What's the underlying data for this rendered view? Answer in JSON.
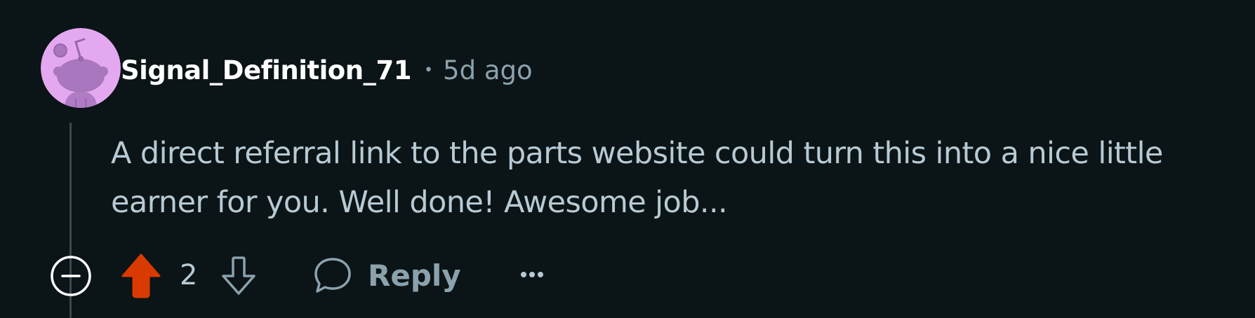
{
  "comment": {
    "username": "Signal_Definition_71",
    "separator": "•",
    "timestamp": "5d ago",
    "body": "A direct referral link to the parts website could turn this into a nice little earner for you. Well done! Awesome job...",
    "avatar_icon": "snoo-avatar",
    "avatar_color": "#e4a8f0"
  },
  "actions": {
    "collapse_icon": "minus-circle-icon",
    "upvote_icon": "upvote-arrow-icon",
    "upvote_active": true,
    "upvote_color": "#d93a00",
    "vote_count": "2",
    "downvote_icon": "downvote-arrow-icon",
    "reply_icon": "speech-bubble-icon",
    "reply_label": "Reply",
    "more_icon": "ellipsis-icon"
  },
  "colors": {
    "background": "#0b1416",
    "text_primary": "#ffffff",
    "text_body": "#b7cad4",
    "text_muted": "#8ba2ad"
  }
}
